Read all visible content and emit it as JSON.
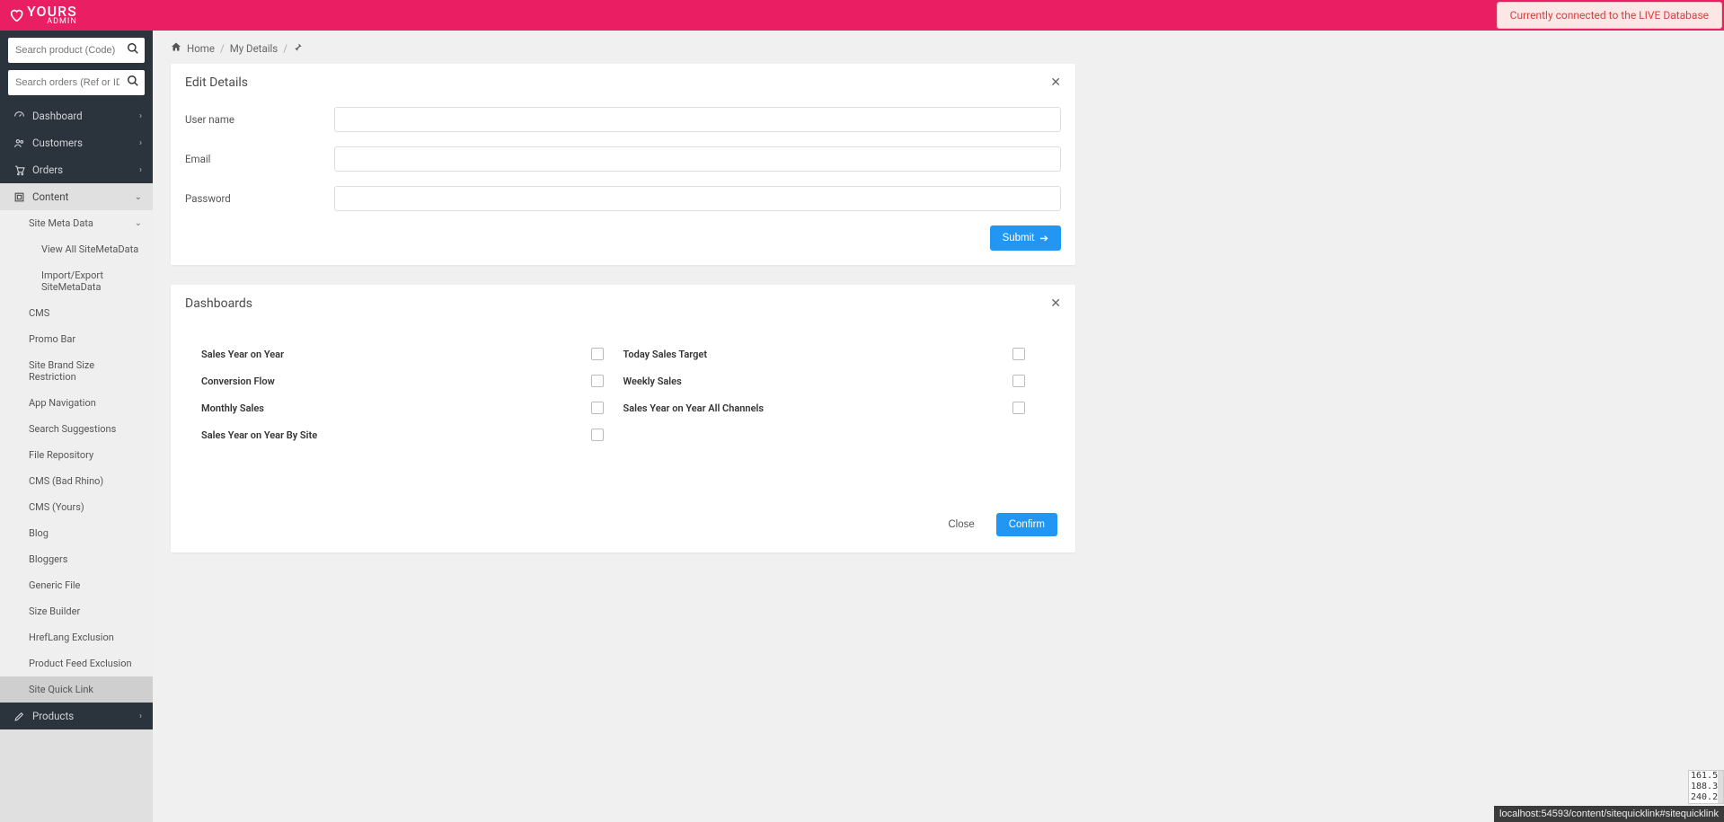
{
  "header": {
    "brand": "YOURS",
    "subtitle": "ADMIN",
    "live_banner": "Currently connected to the LIVE Database"
  },
  "search": {
    "product_placeholder": "Search product (Code)",
    "orders_placeholder": "Search orders (Ref or ID)"
  },
  "sidebar": {
    "dashboard": "Dashboard",
    "customers": "Customers",
    "orders": "Orders",
    "content": "Content",
    "site_meta_data": "Site Meta Data",
    "view_all_smd": "View All SiteMetaData",
    "import_export_smd": "Import/Export SiteMetaData",
    "cms": "CMS",
    "promo_bar": "Promo Bar",
    "site_brand_size": "Site Brand Size Restriction",
    "app_navigation": "App Navigation",
    "search_suggestions": "Search Suggestions",
    "file_repository": "File Repository",
    "cms_bad_rhino": "CMS (Bad Rhino)",
    "cms_yours": "CMS (Yours)",
    "blog": "Blog",
    "bloggers": "Bloggers",
    "generic_file": "Generic File",
    "size_builder": "Size Builder",
    "href_lang_exclusion": "HrefLang Exclusion",
    "product_feed_exclusion": "Product Feed Exclusion",
    "site_quick_link": "Site Quick Link",
    "products": "Products"
  },
  "breadcrumb": {
    "home": "Home",
    "my_details": "My Details"
  },
  "edit_panel": {
    "title": "Edit Details",
    "username_label": "User name",
    "email_label": "Email",
    "password_label": "Password",
    "submit": "Submit"
  },
  "dashboards_panel": {
    "title": "Dashboards",
    "left": [
      "Sales Year on Year",
      "Conversion Flow",
      "Monthly Sales",
      "Sales Year on Year By Site"
    ],
    "right": [
      "Today Sales Target",
      "Weekly Sales",
      "Sales Year on Year All Channels"
    ],
    "close": "Close",
    "confirm": "Confirm"
  },
  "footer": {
    "tooltip": "localhost:54593/content/sitequicklink#sitequicklink",
    "stats": [
      "161.5",
      "188.3",
      "240.2"
    ]
  }
}
